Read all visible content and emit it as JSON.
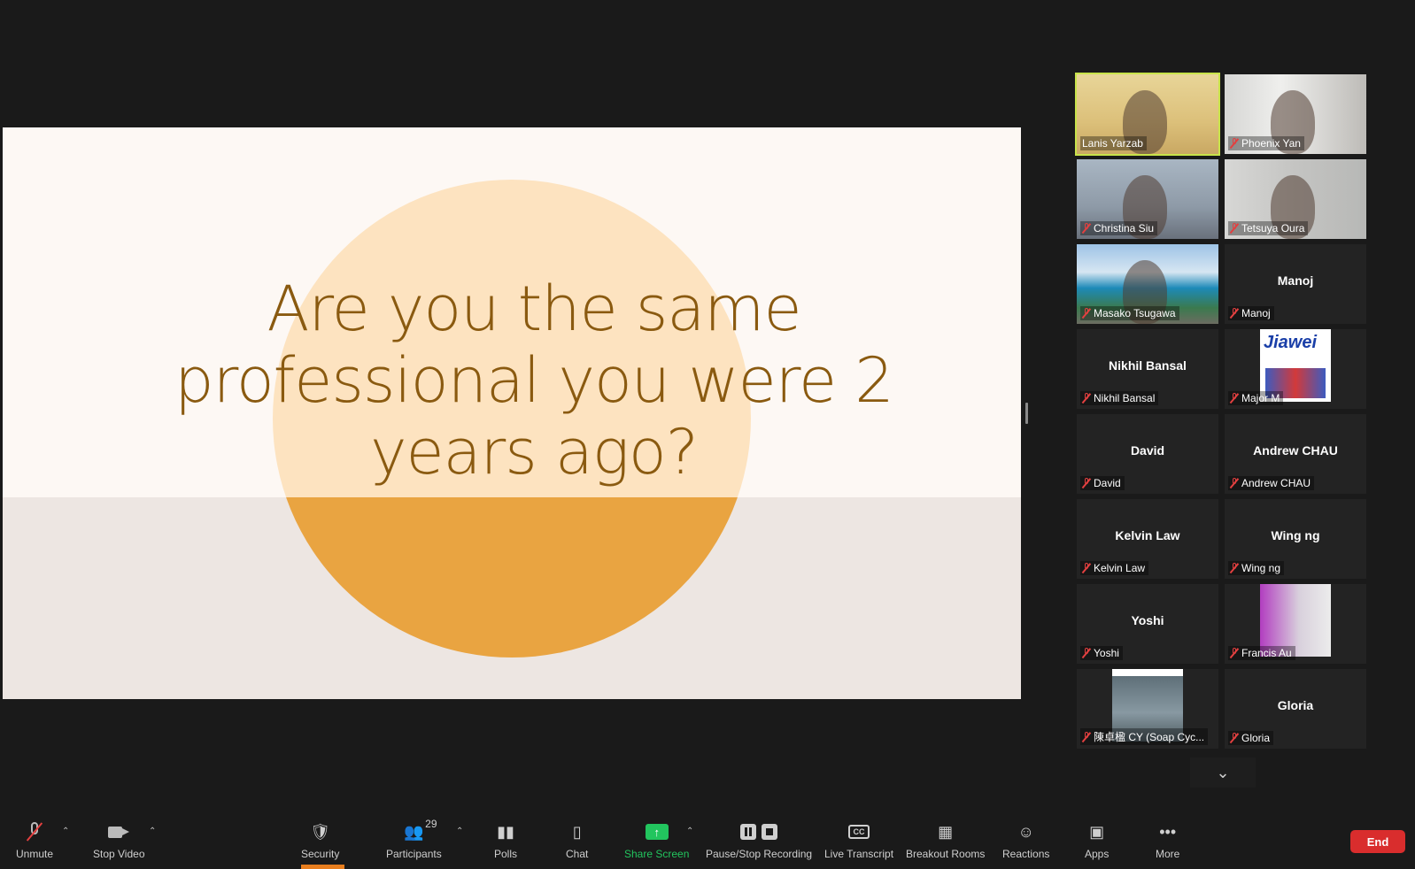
{
  "slide": {
    "text_lines": [
      "Are you the same",
      "professional you were 2",
      "years ago?"
    ]
  },
  "participants": [
    {
      "name": "Lanis Yarzab",
      "muted": false,
      "active": true,
      "video": "lanis"
    },
    {
      "name": "Phoenix Yan",
      "muted": true,
      "video": "phoenix"
    },
    {
      "name": "Christina Siu",
      "muted": true,
      "video": "christina"
    },
    {
      "name": "Tetsuya Oura",
      "muted": true,
      "video": "tetsuya"
    },
    {
      "name": "Masako Tsugawa",
      "muted": true,
      "video": "masako"
    },
    {
      "name": "Manoj",
      "muted": true,
      "big_name": "Manoj"
    },
    {
      "name": "Nikhil Bansal",
      "muted": true,
      "big_name": "Nikhil Bansal"
    },
    {
      "name": "Major M",
      "muted": true,
      "video": "jiawei",
      "logo_text": "Jiawei"
    },
    {
      "name": "David",
      "muted": true,
      "big_name": "David"
    },
    {
      "name": "Andrew CHAU",
      "muted": true,
      "big_name": "Andrew CHAU"
    },
    {
      "name": "Kelvin Law",
      "muted": true,
      "big_name": "Kelvin Law"
    },
    {
      "name": "Wing ng",
      "muted": true,
      "big_name": "Wing ng"
    },
    {
      "name": "Yoshi",
      "muted": true,
      "big_name": "Yoshi"
    },
    {
      "name": "Francis Au",
      "muted": true,
      "video": "francis"
    },
    {
      "name": "陳卓楹 CY (Soap Cyc...",
      "muted": true,
      "video": "bird"
    },
    {
      "name": "Gloria",
      "muted": true,
      "big_name": "Gloria"
    }
  ],
  "toolbar": {
    "unmute": "Unmute",
    "stop_video": "Stop Video",
    "security": "Security",
    "participants": "Participants",
    "participants_count": "29",
    "polls": "Polls",
    "chat": "Chat",
    "share_screen": "Share Screen",
    "recording": "Pause/Stop Recording",
    "live_transcript": "Live Transcript",
    "breakout_rooms": "Breakout Rooms",
    "reactions": "Reactions",
    "apps": "Apps",
    "more": "More",
    "end": "End",
    "cc_text": "CC"
  },
  "colors": {
    "active_speaker": "#c8e34a",
    "share_green": "#22c55e",
    "end_red": "#d92d2d",
    "mute_red": "#e34040"
  }
}
